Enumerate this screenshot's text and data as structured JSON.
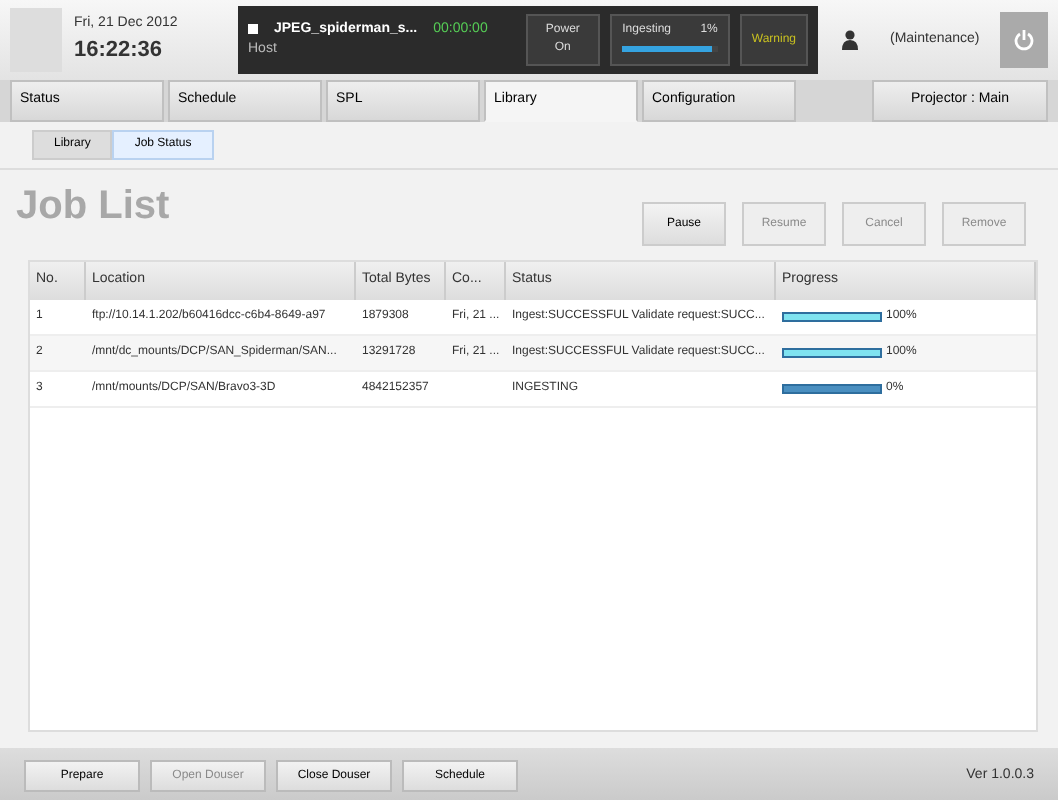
{
  "clock": {
    "date": "Fri, 21 Dec 2012",
    "time": "16:22:36"
  },
  "playback": {
    "title": "JPEG_spiderman_s...",
    "timecode": "00:00:00",
    "state": "Host"
  },
  "indicators": [
    {
      "kind": "button",
      "label": "Power On"
    },
    {
      "kind": "meter",
      "label": "Ingesting",
      "reading": "1%",
      "level": 0.95
    },
    {
      "kind": "warning",
      "label": "Warning"
    }
  ],
  "user": {
    "role": "(Maintenance)"
  },
  "tabs": [
    {
      "label": "Status",
      "selected": false
    },
    {
      "label": "Schedule",
      "selected": false
    },
    {
      "label": "SPL",
      "selected": false
    },
    {
      "label": "Library",
      "selected": true
    },
    {
      "label": "Configuration",
      "selected": false
    }
  ],
  "projector": "Projector : Main",
  "subtabs": [
    {
      "label": "Library",
      "selected": false
    },
    {
      "label": "Job Status",
      "selected": true
    }
  ],
  "title": "Job List",
  "actions": [
    {
      "label": "Pause",
      "disabled": false
    },
    {
      "label": "Resume",
      "disabled": true
    },
    {
      "label": "Cancel",
      "disabled": true
    },
    {
      "label": "Remove",
      "disabled": true
    }
  ],
  "table": {
    "columns": [
      "No.",
      "Location",
      "Total Bytes",
      "Co...",
      "Status",
      "Progress"
    ],
    "rows": [
      {
        "no": "1",
        "location": "ftp://10.14.1.202/b60416dcc-c6b4-8649-a97",
        "bytes": "1879308",
        "co": "Fri, 21 ...",
        "status": "Ingest:SUCCESSFUL Validate request:SUCC...",
        "level": 1,
        "reading": "100%",
        "kind": "done"
      },
      {
        "no": "2",
        "location": "/mnt/dc_mounts/DCP/SAN_Spiderman/SAN...",
        "bytes": "13291728",
        "co": "Fri, 21 ...",
        "status": "Ingest:SUCCESSFUL Validate request:SUCC...",
        "level": 1,
        "reading": "100%",
        "kind": "done"
      },
      {
        "no": "3",
        "location": "/mnt/mounts/DCP/SAN/Bravo3-3D",
        "bytes": "4842152357",
        "status": "INGESTING",
        "level": 1,
        "reading": "0%",
        "kind": "active"
      }
    ]
  },
  "footer": [
    {
      "label": "Prepare",
      "disabled": false
    },
    {
      "label": "Open Douser",
      "disabled": true
    },
    {
      "label": "Close Douser",
      "disabled": false
    },
    {
      "label": "Schedule",
      "disabled": false
    }
  ],
  "version": "Ver 1.0.0.3"
}
